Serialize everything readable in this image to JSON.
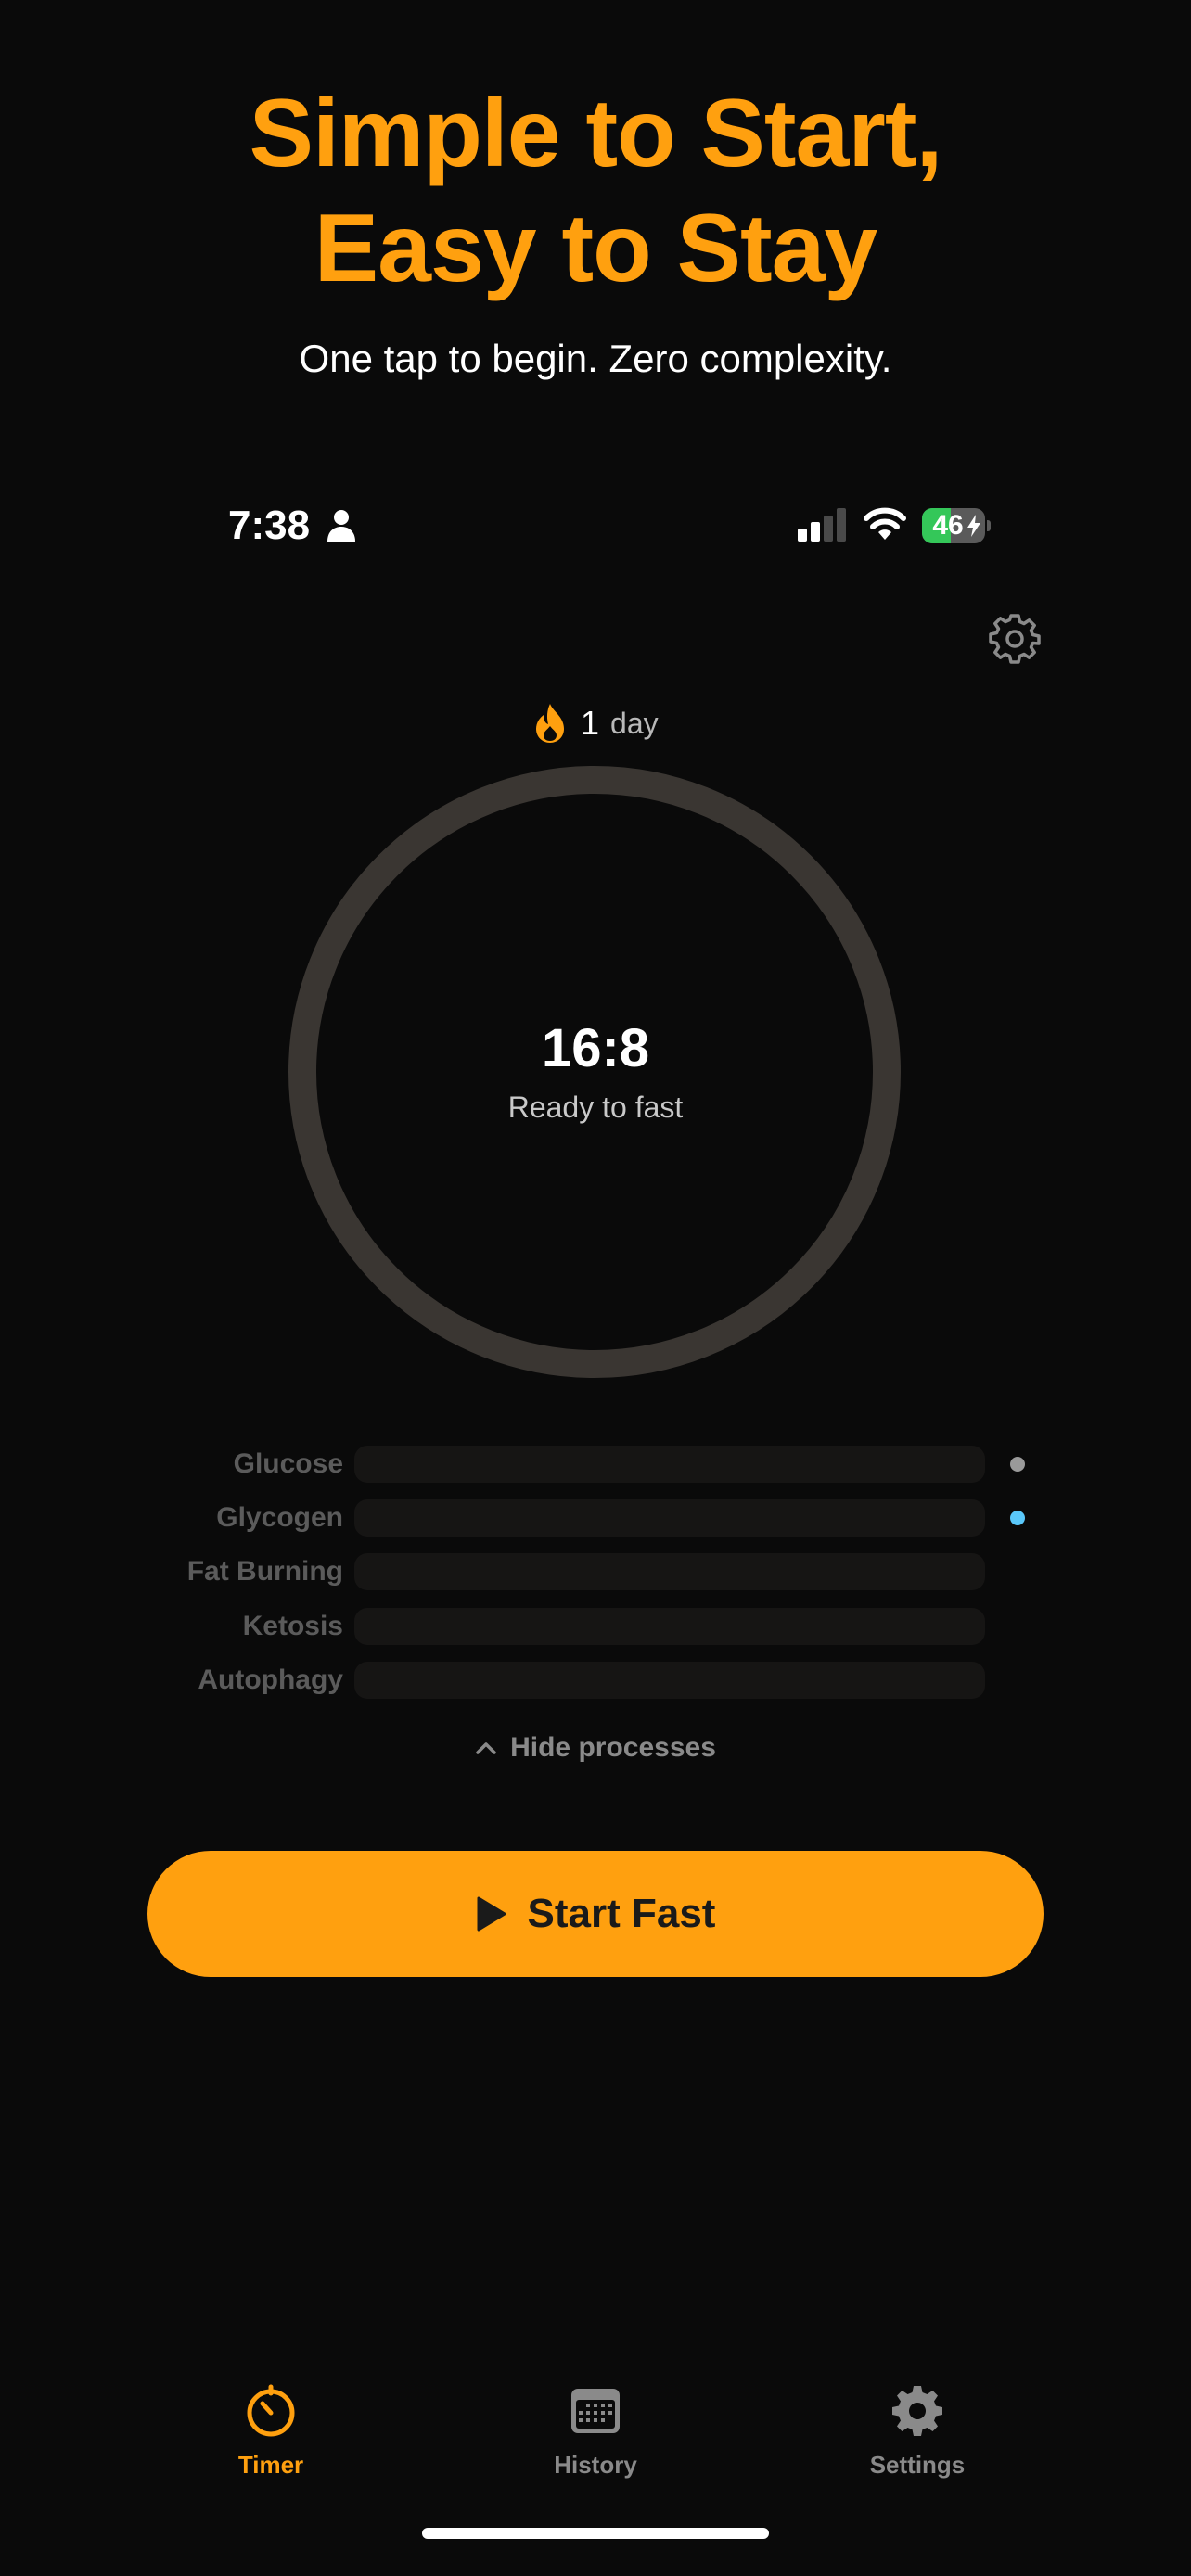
{
  "headline": {
    "line1": "Simple to Start,",
    "line2": "Easy to Stay",
    "subtitle": "One tap to begin. Zero complexity."
  },
  "status_bar": {
    "time": "7:38",
    "battery_level": "46",
    "battery_fraction": 0.46,
    "icons": [
      "person-icon",
      "cellular-signal-icon",
      "wifi-icon",
      "battery-charging-icon"
    ]
  },
  "header": {
    "settings_icon": "gear-icon"
  },
  "streak": {
    "count": "1",
    "unit": "day",
    "icon": "flame-icon"
  },
  "timer": {
    "protocol": "16:8",
    "status": "Ready to fast",
    "progress": 0
  },
  "processes": {
    "items": [
      {
        "label": "Glucose",
        "indicator_color": "#9a9a9a"
      },
      {
        "label": "Glycogen",
        "indicator_color": "#5ac8fa"
      },
      {
        "label": "Fat Burning",
        "indicator_color": ""
      },
      {
        "label": "Ketosis",
        "indicator_color": ""
      },
      {
        "label": "Autophagy",
        "indicator_color": ""
      }
    ],
    "toggle_label": "Hide processes"
  },
  "start_button": {
    "label": "Start Fast",
    "icon": "play-icon"
  },
  "tab_bar": {
    "tabs": [
      {
        "label": "Timer",
        "icon": "timer-icon",
        "active": true
      },
      {
        "label": "History",
        "icon": "calendar-icon",
        "active": false
      },
      {
        "label": "Settings",
        "icon": "gear-icon",
        "active": false
      }
    ]
  },
  "colors": {
    "accent": "#ffa00f",
    "background": "#0a0a0a",
    "ring_track": "#3a3632",
    "inactive_tab": "#8a8a8a"
  }
}
